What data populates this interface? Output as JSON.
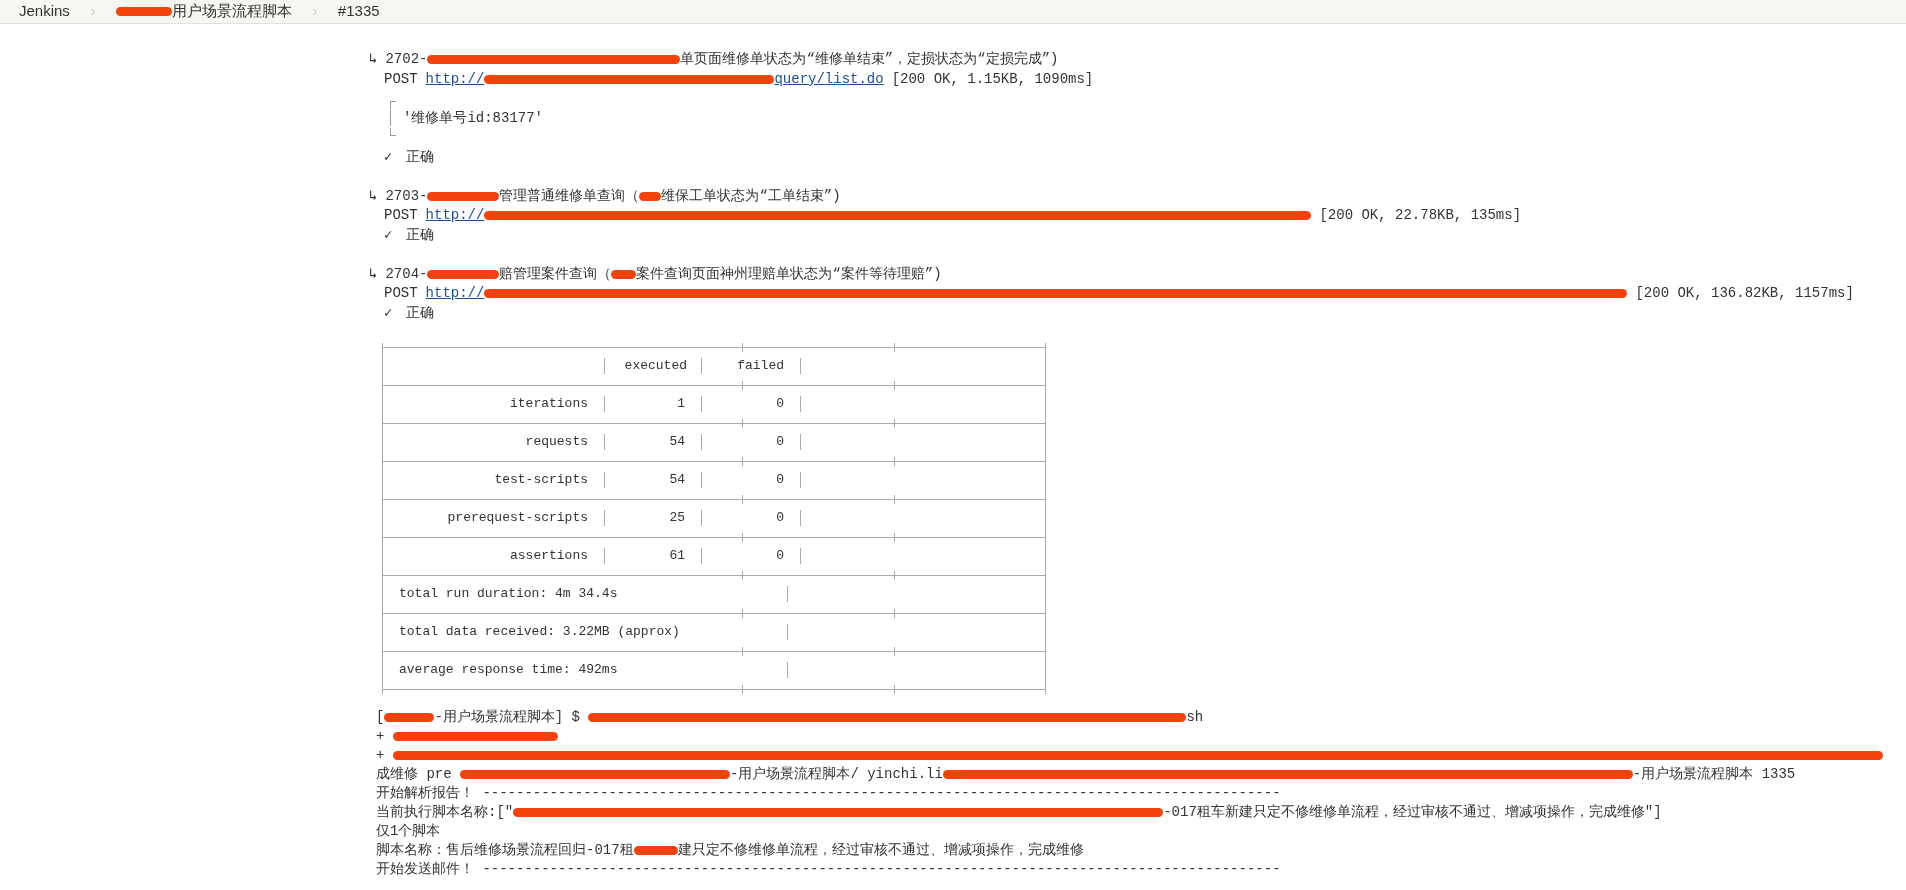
{
  "breadcrumbs": [
    {
      "segments": [
        {
          "kind": "text",
          "text": "Jenkins"
        }
      ]
    },
    {
      "segments": [
        {
          "kind": "redaction"
        },
        {
          "kind": "text",
          "text": "用户场景流程脚本"
        }
      ]
    },
    {
      "segments": [
        {
          "kind": "text",
          "text": "#1335"
        }
      ]
    }
  ],
  "requests": [
    {
      "arrow": "↳",
      "title": [
        {
          "kind": "text",
          "text": "2702-"
        },
        {
          "kind": "redaction"
        },
        {
          "kind": "text",
          "text": "单页面维修单状态为“维修单结束”，定损状态为“定损完成”)"
        }
      ],
      "method": "POST",
      "url": [
        {
          "kind": "link",
          "text": "http://"
        },
        {
          "kind": "redaction"
        },
        {
          "kind": "link",
          "text": "query/list.do"
        }
      ],
      "status": "[200 OK, 1.15KB, 1090ms]",
      "output": "'维修单号id:83177'",
      "result": {
        "mark": "✓",
        "text": "正确"
      }
    },
    {
      "arrow": "↳",
      "title": [
        {
          "kind": "text",
          "text": "2703-"
        },
        {
          "kind": "redaction"
        },
        {
          "kind": "text",
          "text": "管理普通维修单查询（"
        },
        {
          "kind": "redaction"
        },
        {
          "kind": "text",
          "text": "维保工单状态为“工单结束”)"
        }
      ],
      "method": "POST",
      "url": [
        {
          "kind": "link",
          "text": "http://"
        },
        {
          "kind": "redaction"
        }
      ],
      "status": "[200 OK, 22.78KB, 135ms]",
      "result": {
        "mark": "✓",
        "text": "正确"
      }
    },
    {
      "arrow": "↳",
      "title": [
        {
          "kind": "text",
          "text": "2704-"
        },
        {
          "kind": "redaction"
        },
        {
          "kind": "text",
          "text": "赔管理案件查询（"
        },
        {
          "kind": "redaction"
        },
        {
          "kind": "text",
          "text": "案件查询页面神州理赔单状态为“案件等待理赔”)"
        }
      ],
      "method": "POST",
      "url": [
        {
          "kind": "link",
          "text": "http://"
        },
        {
          "kind": "redaction"
        }
      ],
      "status": "[200 OK, 136.82KB, 1157ms]",
      "result": {
        "mark": "✓",
        "text": "正确"
      }
    }
  ],
  "summary_table": {
    "columns": [
      "executed",
      "failed"
    ],
    "rows": [
      {
        "label": "iterations",
        "executed": "1",
        "failed": "0"
      },
      {
        "label": "requests",
        "executed": "54",
        "failed": "0"
      },
      {
        "label": "test-scripts",
        "executed": "54",
        "failed": "0"
      },
      {
        "label": "prerequest-scripts",
        "executed": "25",
        "failed": "0"
      },
      {
        "label": "assertions",
        "executed": "61",
        "failed": "0"
      }
    ],
    "totals": [
      "total run duration: 4m 34.4s",
      "total data received: 3.22MB (approx)",
      "average response time: 492ms"
    ]
  },
  "tail_lines": [
    {
      "segments": [
        {
          "kind": "text",
          "text": "["
        },
        {
          "kind": "redaction"
        },
        {
          "kind": "text",
          "text": "-用户场景流程脚本] $ "
        },
        {
          "kind": "redaction"
        },
        {
          "kind": "text",
          "text": "sh"
        }
      ]
    },
    {
      "segments": [
        {
          "kind": "text",
          "text": "+ "
        },
        {
          "kind": "redaction"
        }
      ]
    },
    {
      "segments": [
        {
          "kind": "text",
          "text": "+ "
        },
        {
          "kind": "redaction"
        }
      ]
    },
    {
      "segments": [
        {
          "kind": "text",
          "text": "成维修 pre "
        },
        {
          "kind": "redaction"
        },
        {
          "kind": "text",
          "text": "-用户场景流程脚本/ yinchi.li"
        },
        {
          "kind": "redaction"
        },
        {
          "kind": "text",
          "text": "-用户场景流程脚本 1335"
        }
      ]
    },
    {
      "segments": [
        {
          "kind": "text",
          "text": "开始解析报告！ -----------------------------------------------------------------------------------------------"
        }
      ]
    },
    {
      "segments": [
        {
          "kind": "text",
          "text": "当前执行脚本名称:[\""
        },
        {
          "kind": "redaction"
        },
        {
          "kind": "text",
          "text": "-017租车新建只定不修维修单流程，经过审核不通过、增减项操作，完成维修\"]"
        }
      ]
    },
    {
      "segments": [
        {
          "kind": "text",
          "text": "仅1个脚本"
        }
      ]
    },
    {
      "segments": [
        {
          "kind": "text",
          "text": "脚本名称：售后维修场景流程回归-017租"
        },
        {
          "kind": "redaction"
        },
        {
          "kind": "text",
          "text": "建只定不修维修单流程，经过审核不通过、增减项操作，完成维修"
        }
      ]
    },
    {
      "segments": [
        {
          "kind": "text",
          "text": "开始发送邮件！ -----------------------------------------------------------------------------------------------"
        }
      ]
    }
  ]
}
